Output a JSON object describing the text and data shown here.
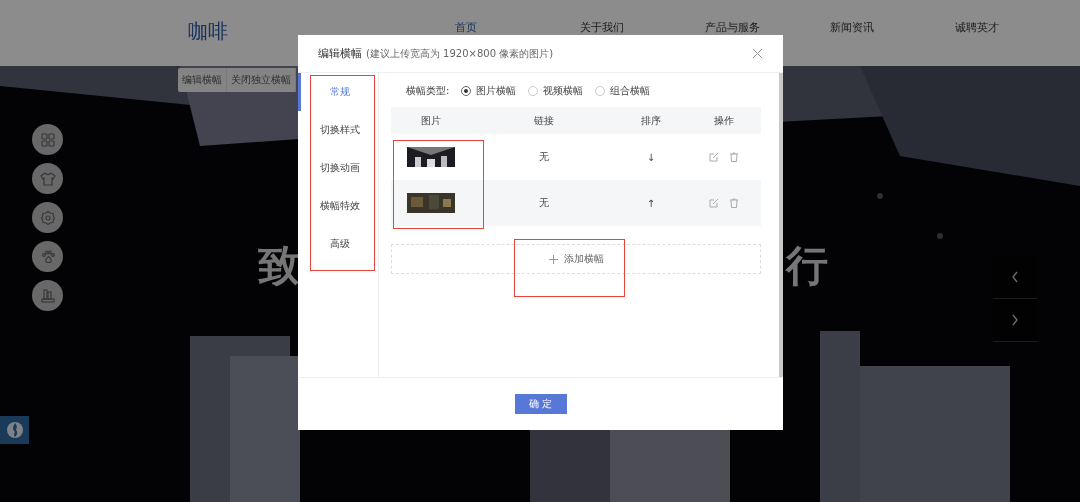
{
  "site": {
    "logo": "咖啡",
    "nav": [
      {
        "label": "首页",
        "selected": true
      },
      {
        "label": "关于我们",
        "selected": false
      },
      {
        "label": "产品与服务",
        "selected": false
      },
      {
        "label": "新闻资讯",
        "selected": false
      },
      {
        "label": "诚聘英才",
        "selected": false
      }
    ]
  },
  "banner_toolbar": [
    "编辑横幅",
    "关闭独立横幅"
  ],
  "hero": {
    "text_left": "致",
    "text_right": "行"
  },
  "side_tools": [
    {
      "kind": "grid"
    },
    {
      "kind": "shirt"
    },
    {
      "kind": "gear"
    },
    {
      "kind": "paw"
    },
    {
      "kind": "building"
    }
  ],
  "modal": {
    "title": "编辑横幅",
    "hint": "(建议上传宽高为 1920×800 像素的图片)",
    "tabs": [
      {
        "label": "常规",
        "selected": true
      },
      {
        "label": "切换样式",
        "selected": false
      },
      {
        "label": "切换动画",
        "selected": false
      },
      {
        "label": "横幅特效",
        "selected": false
      },
      {
        "label": "高级",
        "selected": false
      }
    ],
    "type_label": "横幅类型:",
    "types": [
      {
        "label": "图片横幅",
        "selected": true
      },
      {
        "label": "视频横幅",
        "selected": false
      },
      {
        "label": "组合横幅",
        "selected": false
      }
    ],
    "columns": [
      "图片",
      "链接",
      "排序",
      "操作"
    ],
    "rows": [
      {
        "link": "无",
        "order": "↓"
      },
      {
        "link": "无",
        "order": "↑"
      }
    ],
    "add_label": "添加横幅",
    "confirm": "确 定"
  }
}
